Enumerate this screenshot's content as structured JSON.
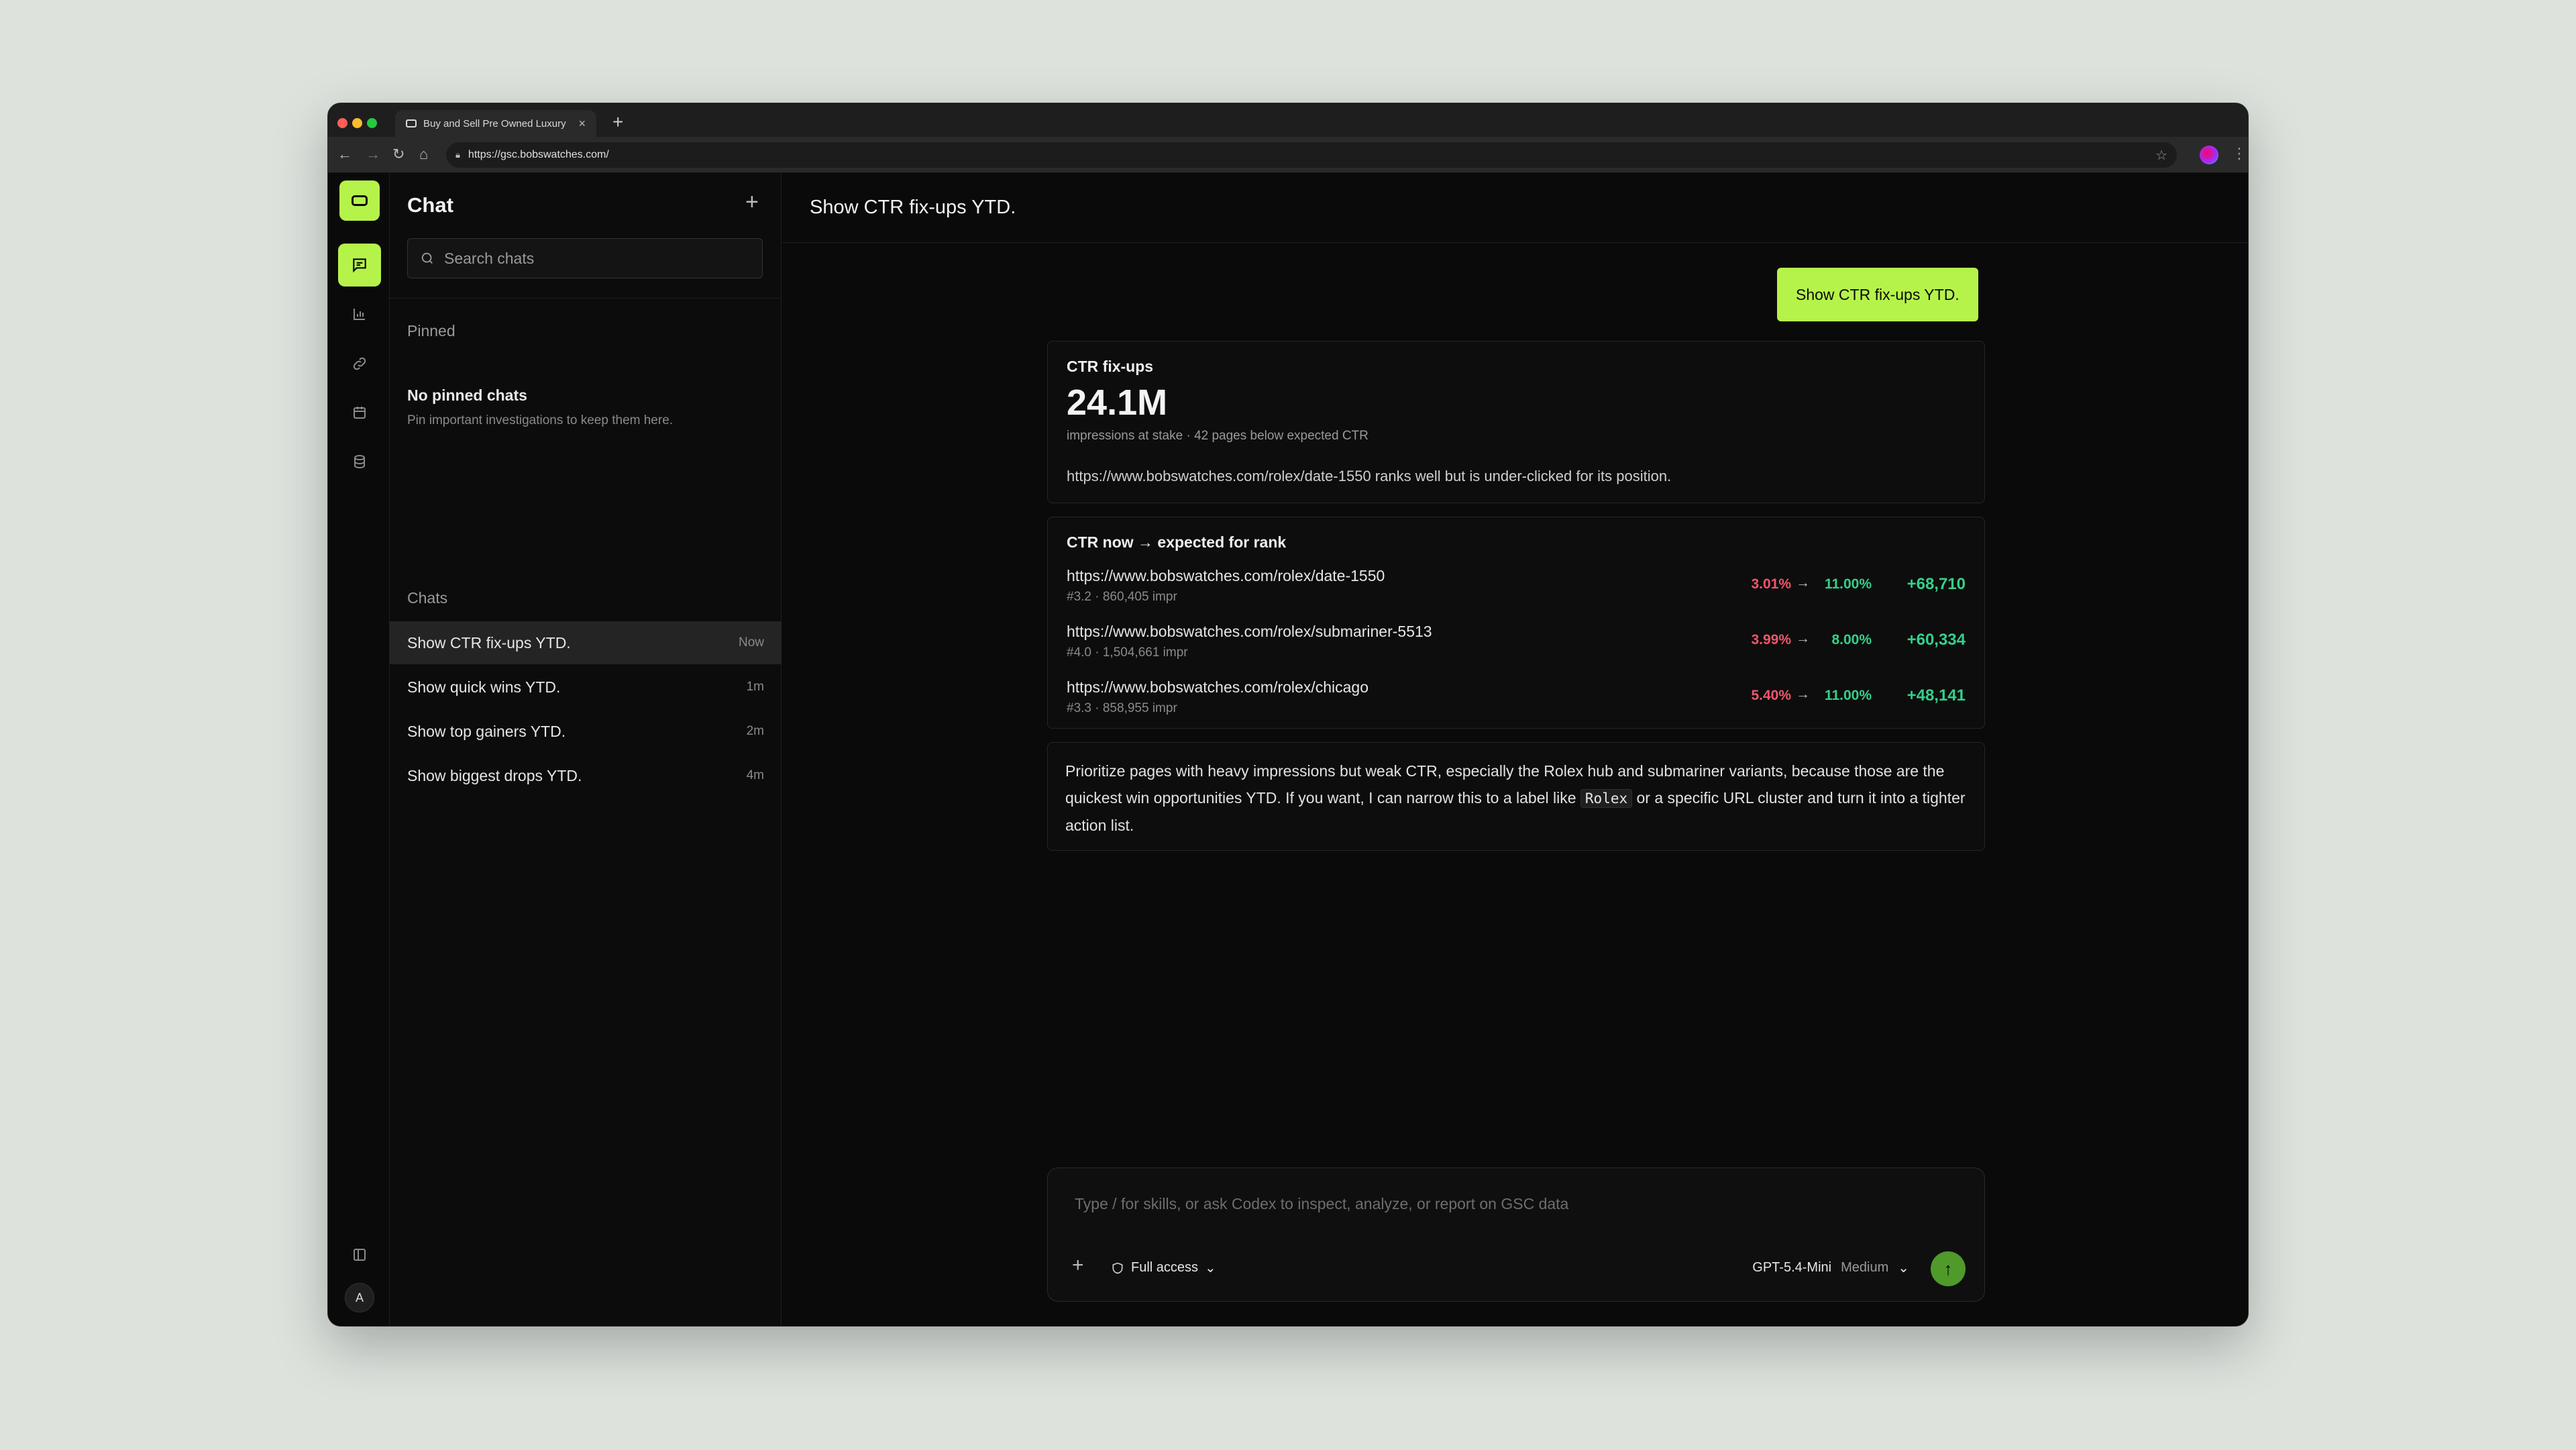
{
  "browser": {
    "tab_title": "Buy and Sell Pre Owned Luxury",
    "tab_close": "×",
    "new_tab": "+",
    "url": "https://gsc.bobswatches.com/"
  },
  "sidebar": {
    "title": "Chat",
    "new_chat": "+",
    "search_placeholder": "Search chats",
    "pinned_label": "Pinned",
    "pinned_empty_title": "No pinned chats",
    "pinned_empty_sub": "Pin important investigations to keep them here.",
    "chats_label": "Chats",
    "chats": [
      {
        "label": "Show CTR fix-ups YTD.",
        "time": "Now"
      },
      {
        "label": "Show quick wins YTD.",
        "time": "1m"
      },
      {
        "label": "Show top gainers YTD.",
        "time": "2m"
      },
      {
        "label": "Show biggest drops YTD.",
        "time": "4m"
      }
    ]
  },
  "rail": {
    "icons": [
      "chat-icon",
      "chart-icon",
      "link-icon",
      "calendar-icon",
      "database-icon",
      "panel-icon"
    ],
    "avatar": "A"
  },
  "main": {
    "header": "Show CTR fix-ups YTD.",
    "user_message": "Show CTR fix-ups YTD.",
    "summary": {
      "title": "CTR fix-ups",
      "value": "24.1M",
      "sub": "impressions at stake · 42 pages below expected CTR",
      "note": "https://www.bobswatches.com/rolex/date-1550 ranks well but is under-clicked for its position."
    },
    "table": {
      "title": "CTR now → expected for rank",
      "rows": [
        {
          "url": "https://www.bobswatches.com/rolex/date-1550",
          "meta": "#3.2 · 860,405 impr",
          "now": "3.01%",
          "expected": "11.00%",
          "delta": "+68,710"
        },
        {
          "url": "https://www.bobswatches.com/rolex/submariner-5513",
          "meta": "#4.0 · 1,504,661 impr",
          "now": "3.99%",
          "expected": "8.00%",
          "delta": "+60,334"
        },
        {
          "url": "https://www.bobswatches.com/rolex/chicago",
          "meta": "#3.3 · 858,955 impr",
          "now": "5.40%",
          "expected": "11.00%",
          "delta": "+48,141"
        }
      ]
    },
    "advice": {
      "before": "Prioritize pages with heavy impressions but weak CTR, especially the Rolex hub and submariner variants, because those are the quickest win opportunities YTD. If you want, I can narrow this to a label like ",
      "code": "Rolex",
      "after": " or a specific URL cluster and turn it into a tighter action list."
    },
    "composer": {
      "placeholder": "Type / for skills, or ask Codex to inspect, analyze, or report on GSC data",
      "access": "Full access",
      "model": "GPT-5.4-Mini",
      "effort": "Medium"
    }
  },
  "colors": {
    "accent": "#b6f34a",
    "negative": "#f0566a",
    "positive": "#35d08a"
  }
}
